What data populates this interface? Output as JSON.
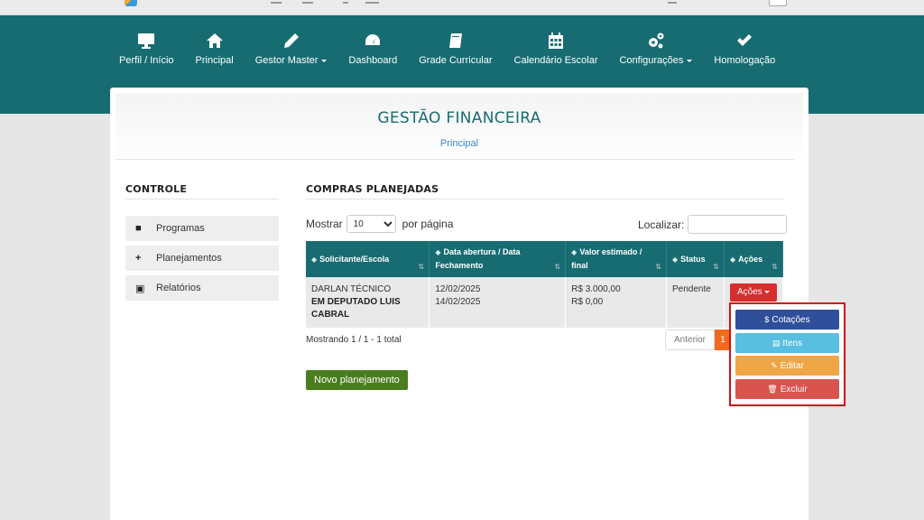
{
  "nav": {
    "items": [
      {
        "label": "Perfil / Início",
        "icon": "monitor-icon",
        "dropdown": false
      },
      {
        "label": "Principal",
        "icon": "home-icon",
        "dropdown": false
      },
      {
        "label": "Gestor Master",
        "icon": "pencil-icon",
        "dropdown": true
      },
      {
        "label": "Dashboard",
        "icon": "dashboard-icon",
        "dropdown": false
      },
      {
        "label": "Grade Curricular",
        "icon": "book-icon",
        "dropdown": false
      },
      {
        "label": "Calendário Escolar",
        "icon": "calendar-icon",
        "dropdown": false
      },
      {
        "label": "Configurações",
        "icon": "gears-icon",
        "dropdown": true
      },
      {
        "label": "Homologação",
        "icon": "check-icon",
        "dropdown": false
      }
    ]
  },
  "header": {
    "title": "GESTÃO FINANCEIRA",
    "breadcrumb": "Principal"
  },
  "sidebar": {
    "title": "CONTROLE",
    "items": [
      {
        "label": "Programas",
        "icon": "folder-icon"
      },
      {
        "label": "Planejamentos",
        "icon": "plus-icon"
      },
      {
        "label": "Relatórios",
        "icon": "archive-icon"
      }
    ]
  },
  "main": {
    "title": "COMPRAS PLANEJADAS",
    "show_label": "Mostrar",
    "per_page_value": "10",
    "per_page_suffix": "por página",
    "search_label": "Localizar:",
    "search_value": "",
    "columns": [
      "Solicitante/Escola",
      "Data abertura / Data Fechamento",
      "Valor estimado / final",
      "Status",
      "Ações"
    ],
    "rows": [
      {
        "solicitante": "DARLAN TÉCNICO",
        "escola": "EM DEPUTADO LUIS CABRAL",
        "data_abertura": "12/02/2025",
        "data_fechamento": "14/02/2025",
        "valor_estimado": "R$ 3.000,00",
        "valor_final": "R$ 0,00",
        "status": "Pendente",
        "acoes_label": "Ações"
      }
    ],
    "showing_text": "Mostrando 1 / 1 - 1 total",
    "pager_prev": "Anterior",
    "pager_current": "1",
    "new_button": "Novo planejamento"
  },
  "actions_menu": {
    "items": [
      {
        "label": "Cotações",
        "icon": "dollar-icon",
        "glyph": "$",
        "color": "#2f4f9a"
      },
      {
        "label": "Itens",
        "icon": "list-icon",
        "glyph": "▤",
        "color": "#58bfe0"
      },
      {
        "label": "Editar",
        "icon": "edit-icon",
        "glyph": "✎",
        "color": "#eea646"
      },
      {
        "label": "Excluir",
        "icon": "trash-icon",
        "glyph": "🗑",
        "color": "#d9534f"
      }
    ]
  },
  "colors": {
    "nav_bg": "#176c72",
    "accent_orange": "#f26b1d",
    "new_button": "#4a7d1e",
    "actions_button": "#d62d2d",
    "highlight_box": "#e3131b"
  }
}
